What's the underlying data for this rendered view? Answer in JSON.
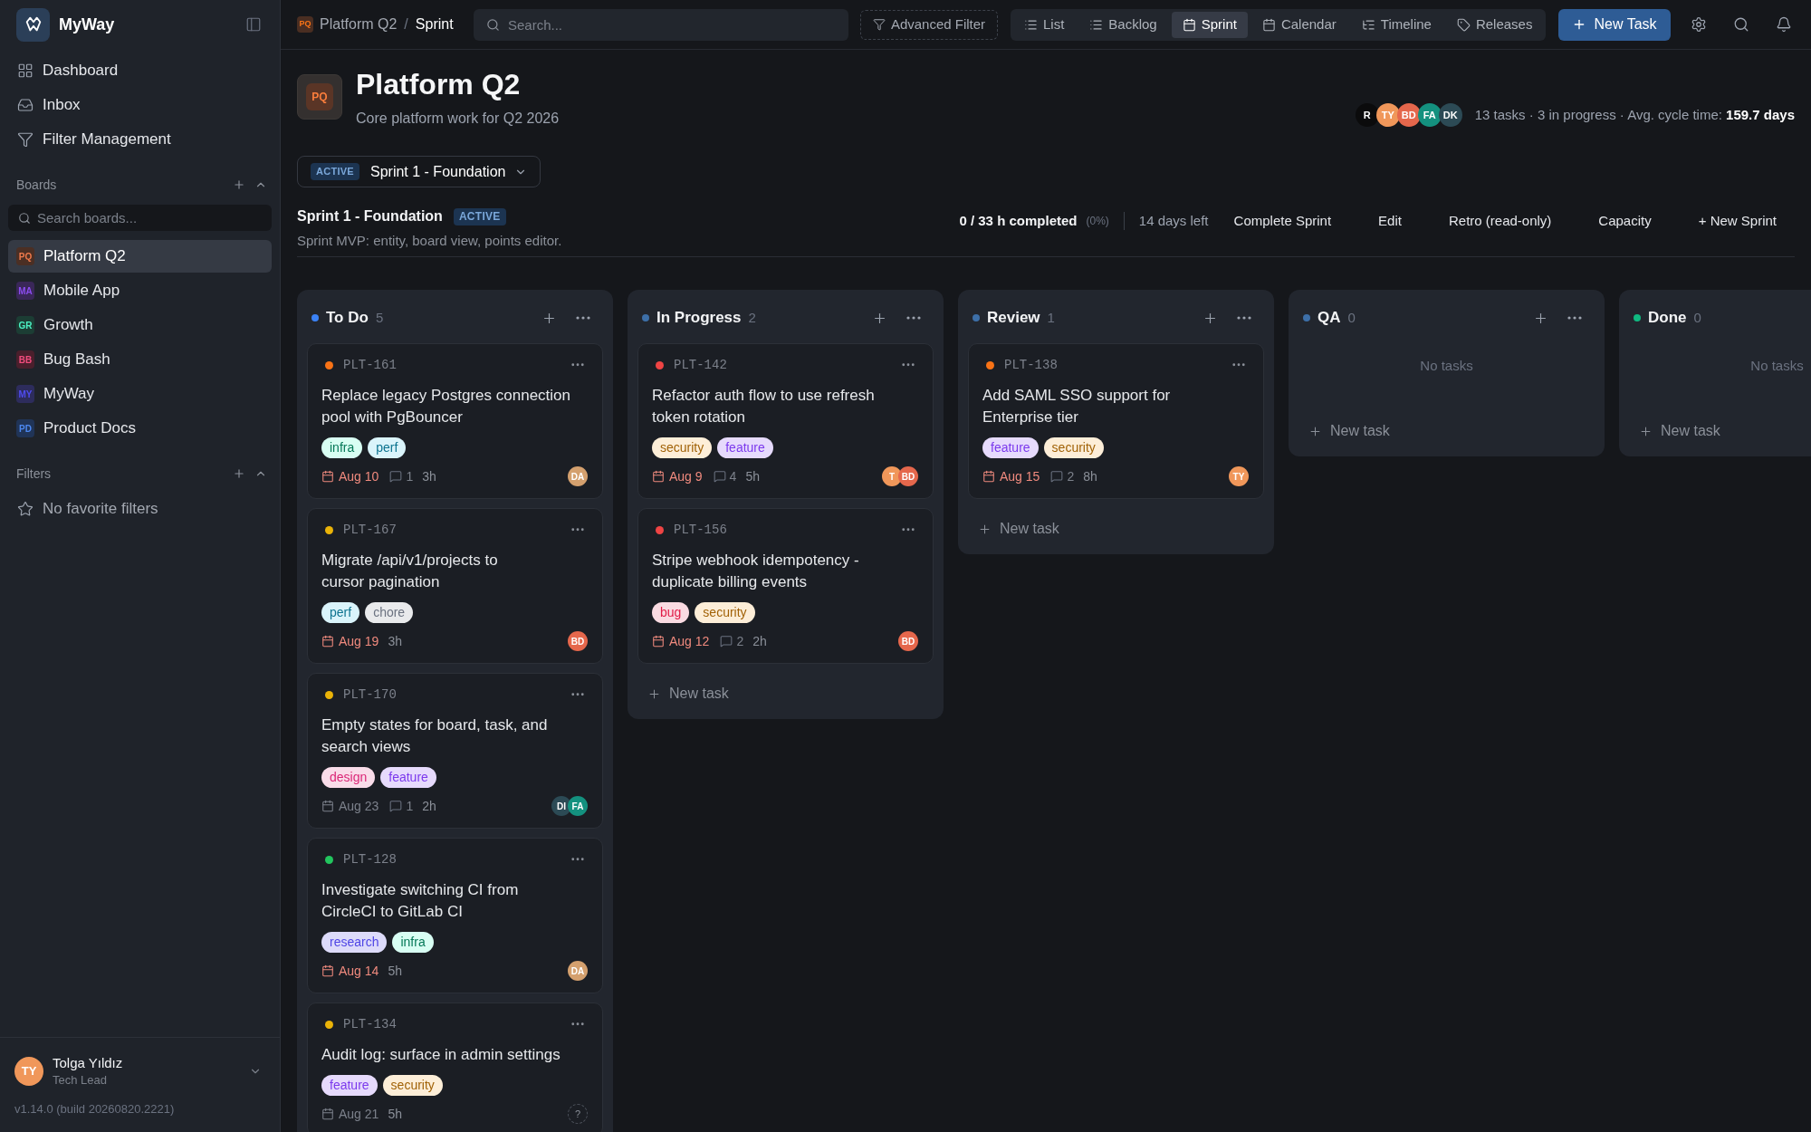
{
  "sidebar": {
    "brand": "MyWay",
    "nav": [
      "Dashboard",
      "Inbox",
      "Filter Management"
    ],
    "boards": {
      "title": "Boards",
      "search": {
        "placeholder": "Search boards..."
      },
      "items": [
        {
          "badge": "PQ",
          "label": "Platform Q2",
          "color": "#4b2f24",
          "selected": true
        },
        {
          "badge": "MA",
          "label": "Mobile App",
          "color": "#3a2758",
          "selected": false
        },
        {
          "badge": "GR",
          "label": "Growth",
          "color": "#1c3d34",
          "selected": false
        },
        {
          "badge": "BB",
          "label": "Bug Bash",
          "color": "#4a1f2c",
          "selected": false
        },
        {
          "badge": "MY",
          "label": "MyWay",
          "color": "#2d2c5c",
          "selected": false
        },
        {
          "badge": "PD",
          "label": "Product Docs",
          "color": "#203457",
          "selected": false
        }
      ]
    },
    "filters": {
      "title": "Filters",
      "empty": "No favorite filters"
    },
    "user": {
      "initials": "TY",
      "name": "Tolga Yıldız",
      "role": "Tech Lead"
    },
    "version": "v1.14.0 (build 20260820.2221)"
  },
  "topbar": {
    "breadcrumb": {
      "badge": "PQ",
      "board": "Platform Q2",
      "separator": "/",
      "page": "Sprint"
    },
    "search": {
      "placeholder": "Search..."
    },
    "advanced_filter": "Advanced Filter",
    "views": [
      {
        "label": "List",
        "selected": false
      },
      {
        "label": "Backlog",
        "selected": false
      },
      {
        "label": "Sprint",
        "selected": true
      },
      {
        "label": "Calendar",
        "selected": false
      },
      {
        "label": "Timeline",
        "selected": false
      },
      {
        "label": "Releases",
        "selected": false
      }
    ],
    "new_task": "New Task"
  },
  "header": {
    "badge": "PQ",
    "title": "Platform Q2",
    "subtitle": "Core platform work for Q2 2026",
    "members": [
      {
        "initials": "R",
        "color": "#0b0b0c"
      },
      {
        "initials": "TY",
        "color": "#f0975a"
      },
      {
        "initials": "BD",
        "color": "#e5674c"
      },
      {
        "initials": "FA",
        "color": "#14917f"
      },
      {
        "initials": "DK",
        "color": "#2c4a55"
      }
    ],
    "stats": "13 tasks · 3 in progress · Avg. cycle time: **159.7 days**"
  },
  "sprint_select": {
    "status": "ACTIVE",
    "name": "Sprint 1 - Foundation"
  },
  "sprint": {
    "name": "Sprint 1 - Foundation",
    "status": "ACTIVE",
    "description": "Sprint MVP: entity, board view, points editor.",
    "completed": "0 / 33 h completed",
    "percent": "(0%)",
    "days_left": "14 days left",
    "actions": [
      "Complete Sprint",
      "Edit",
      "Retro (read-only)",
      "Capacity",
      "+ New Sprint"
    ]
  },
  "columns": [
    {
      "title": "To Do",
      "count": "5",
      "color": "#3b82f6",
      "cards": [
        {
          "id": "PLT-161",
          "color": "#f97316",
          "title": "Replace legacy Postgres connection pool with PgBouncer",
          "tags": [
            {
              "label": "infra",
              "color": "#047857"
            },
            {
              "label": "perf",
              "color": "#0e7490"
            }
          ],
          "due": "Aug 10",
          "overdue": true,
          "comments": "1",
          "estimate": "3h",
          "assignees": [
            {
              "kind": "person",
              "initials": "DA",
              "color": "#d4a06e"
            }
          ]
        },
        {
          "id": "PLT-167",
          "color": "#eab308",
          "title": "Migrate /api/v1/projects to cursor pagination",
          "tags": [
            {
              "label": "perf",
              "color": "#0e7490"
            },
            {
              "label": "chore",
              "color": "#6b7280"
            }
          ],
          "due": "Aug 19",
          "overdue": true,
          "estimate": "3h",
          "assignees": [
            {
              "kind": "person",
              "initials": "BD",
              "color": "#e5674c"
            }
          ]
        },
        {
          "id": "PLT-170",
          "color": "#eab308",
          "title": "Empty states for board, task, and search views",
          "tags": [
            {
              "label": "design",
              "color": "#db2777"
            },
            {
              "label": "feature",
              "color": "#7c3aed"
            }
          ],
          "due": "Aug 23",
          "overdue": false,
          "comments": "1",
          "estimate": "2h",
          "assignees": [
            {
              "kind": "person",
              "initials": "DI",
              "color": "#2c4a55"
            },
            {
              "kind": "person",
              "initials": "FA",
              "color": "#14917f"
            }
          ]
        },
        {
          "id": "PLT-128",
          "color": "#22c55e",
          "title": "Investigate switching CI from CircleCI to GitLab CI",
          "tags": [
            {
              "label": "research",
              "color": "#4f46e5"
            },
            {
              "label": "infra",
              "color": "#047857"
            }
          ],
          "due": "Aug 14",
          "overdue": true,
          "estimate": "5h",
          "assignees": [
            {
              "kind": "person",
              "initials": "DA",
              "color": "#d4a06e"
            }
          ]
        },
        {
          "id": "PLT-134",
          "color": "#eab308",
          "title": "Audit log: surface in admin settings",
          "tags": [
            {
              "label": "feature",
              "color": "#7c3aed"
            },
            {
              "label": "security",
              "color": "#a16207"
            }
          ],
          "due": "Aug 21",
          "overdue": false,
          "estimate": "5h",
          "assignees": [
            {
              "kind": "unassigned",
              "initials": "?"
            }
          ]
        }
      ]
    },
    {
      "title": "In Progress",
      "count": "2",
      "color": "#3d6fa8",
      "cards": [
        {
          "id": "PLT-142",
          "color": "#ef4444",
          "title": "Refactor auth flow to use refresh token rotation",
          "tags": [
            {
              "label": "security",
              "color": "#a16207"
            },
            {
              "label": "feature",
              "color": "#7c3aed"
            }
          ],
          "due": "Aug 9",
          "overdue": true,
          "comments": "4",
          "estimate": "5h",
          "assignees": [
            {
              "kind": "person",
              "initials": "T",
              "color": "#f0975a"
            },
            {
              "kind": "person",
              "initials": "BD",
              "color": "#e5674c"
            }
          ]
        },
        {
          "id": "PLT-156",
          "color": "#ef4444",
          "title": "Stripe webhook idempotency - duplicate billing events",
          "tags": [
            {
              "label": "bug",
              "color": "#e11d48"
            },
            {
              "label": "security",
              "color": "#a16207"
            }
          ],
          "due": "Aug 12",
          "overdue": true,
          "comments": "2",
          "estimate": "2h",
          "assignees": [
            {
              "kind": "person",
              "initials": "BD",
              "color": "#e5674c"
            }
          ]
        }
      ],
      "new_task": "New task"
    },
    {
      "title": "Review",
      "count": "1",
      "color": "#3d6fa8",
      "cards": [
        {
          "id": "PLT-138",
          "color": "#f97316",
          "title": "Add SAML SSO support for Enterprise tier",
          "tags": [
            {
              "label": "feature",
              "color": "#7c3aed"
            },
            {
              "label": "security",
              "color": "#a16207"
            }
          ],
          "due": "Aug 15",
          "overdue": true,
          "comments": "2",
          "estimate": "8h",
          "assignees": [
            {
              "kind": "person",
              "initials": "TY",
              "color": "#f0975a"
            }
          ]
        }
      ],
      "new_task": "New task"
    },
    {
      "title": "QA",
      "count": "0",
      "color": "#3d6fa8",
      "empty": "No tasks",
      "new_task": "New task"
    },
    {
      "title": "Done",
      "count": "0",
      "color": "#10b981",
      "empty": "No tasks",
      "new_task": "New task"
    }
  ]
}
